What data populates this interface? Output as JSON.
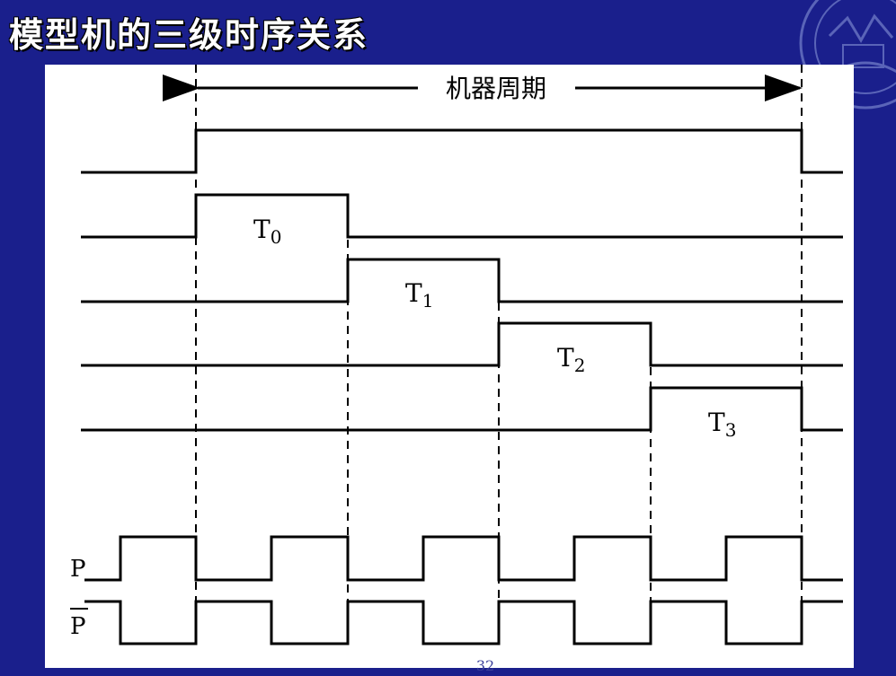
{
  "title": "模型机的三级时序关系",
  "page_number": "32",
  "colors": {
    "background": "#1a1f8c",
    "panel": "#ffffff",
    "ink": "#000000",
    "seal": "#5a64b8"
  },
  "diagram": {
    "period_label": "机器周期",
    "t_labels": [
      {
        "base": "T",
        "sub": "0"
      },
      {
        "base": "T",
        "sub": "1"
      },
      {
        "base": "T",
        "sub": "2"
      },
      {
        "base": "T",
        "sub": "3"
      }
    ],
    "p_label": "P",
    "pbar_label": "P"
  }
}
